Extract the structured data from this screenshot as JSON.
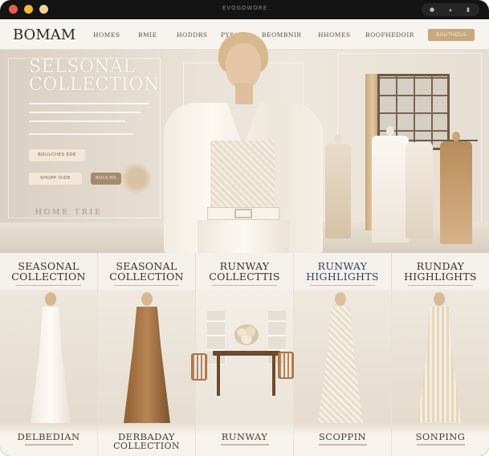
{
  "window": {
    "title": "EVOGOWORE"
  },
  "nav": {
    "logo": "BOMAM",
    "links": [
      "HOMES",
      "BMIE",
      "HODDRS",
      "PYS",
      "BEOMBNIR",
      "HHOMES",
      "BOOFHEDOIR"
    ],
    "cta": "BOUTHDUS"
  },
  "hero": {
    "title_line1": "SELSONAL",
    "title_line2": "COLLECTION",
    "button_primary": "BOULCHES EDE",
    "button_secondary": "SHOPP DIDE",
    "button_tertiary": "BOUCHS",
    "watermark": "HOME TRIE"
  },
  "categories": [
    {
      "line1": "SEASONAL",
      "line2": "COLLECTION",
      "style": "dark"
    },
    {
      "line1": "SEASONAL",
      "line2": "COLLECTION",
      "style": "dark"
    },
    {
      "line1": "RUNWAY",
      "line2": "COLLECTTIS",
      "style": "dark"
    },
    {
      "line1": "RUNWAY",
      "line2": "HIGHLIGHTS",
      "style": "blue"
    },
    {
      "line1": "RUNDAY",
      "line2": "HIGHLIGHTS",
      "style": "dark"
    }
  ],
  "cards": [
    {
      "line1": "DELBEDIAN",
      "line2": ""
    },
    {
      "line1": "DERBADAY",
      "line2": "COLLECTION"
    },
    {
      "line1": "RUNWAY",
      "line2": ""
    },
    {
      "line1": "SCOPPIN",
      "line2": ""
    },
    {
      "line1": "SONPING",
      "line2": ""
    }
  ],
  "colors": {
    "accent": "#c7a77d",
    "background": "#f3eee7",
    "titlebar": "#141414",
    "blue_text": "#2f3f63"
  }
}
